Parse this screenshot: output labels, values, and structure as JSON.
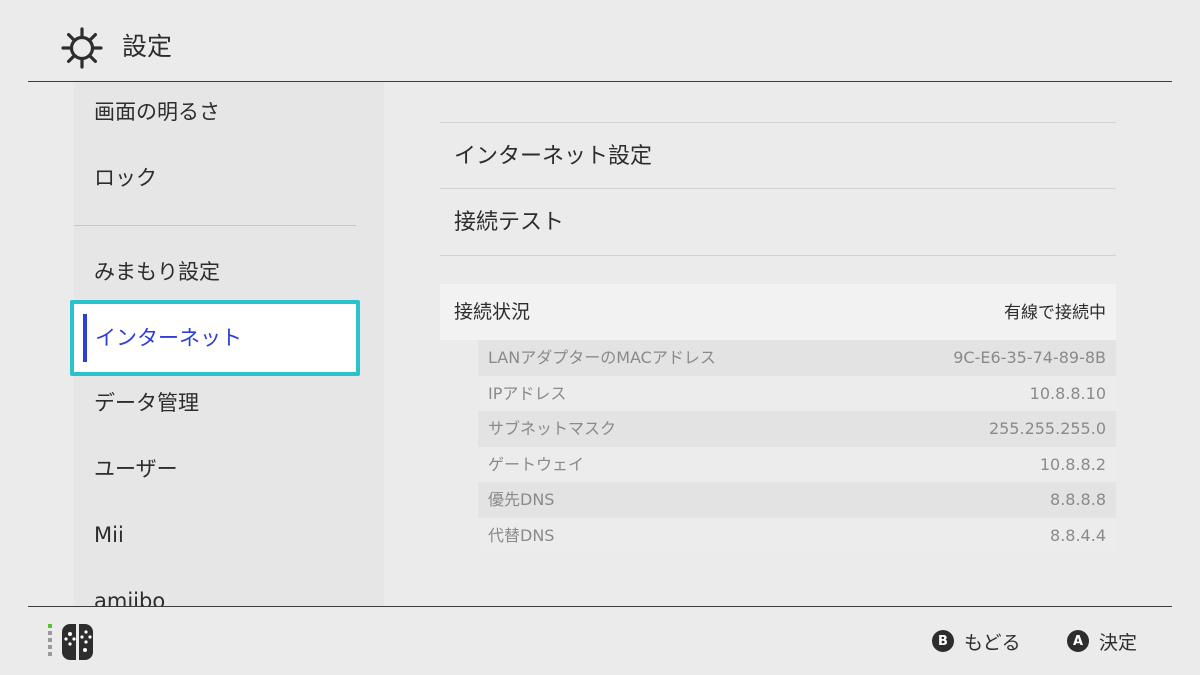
{
  "header": {
    "title": "設定",
    "icon": "gear-icon"
  },
  "sidebar": {
    "items": [
      {
        "label": "画面の明るさ"
      },
      {
        "label": "ロック"
      },
      {
        "label": "みまもり設定"
      },
      {
        "label": "インターネット",
        "selected": true
      },
      {
        "label": "データ管理"
      },
      {
        "label": "ユーザー"
      },
      {
        "label": "Mii"
      },
      {
        "label": "amiibo"
      }
    ],
    "accent_color": "#2d40d6",
    "focus_color": "#28c3cf"
  },
  "main": {
    "items": [
      {
        "label": "インターネット設定"
      },
      {
        "label": "接続テスト"
      }
    ],
    "status": {
      "label": "接続状況",
      "value": "有線で接続中"
    },
    "details": [
      {
        "label": "LANアダプターのMACアドレス",
        "value": "9C-E6-35-74-89-8B"
      },
      {
        "label": "IPアドレス",
        "value": "10.8.8.10"
      },
      {
        "label": "サブネットマスク",
        "value": "255.255.255.0"
      },
      {
        "label": "ゲートウェイ",
        "value": "10.8.8.2"
      },
      {
        "label": "優先DNS",
        "value": "8.8.8.8"
      },
      {
        "label": "代替DNS",
        "value": "8.8.4.4"
      }
    ]
  },
  "footer": {
    "controller_icon": "joycon-icon",
    "back": {
      "button": "B",
      "label": "もどる"
    },
    "confirm": {
      "button": "A",
      "label": "決定"
    }
  }
}
